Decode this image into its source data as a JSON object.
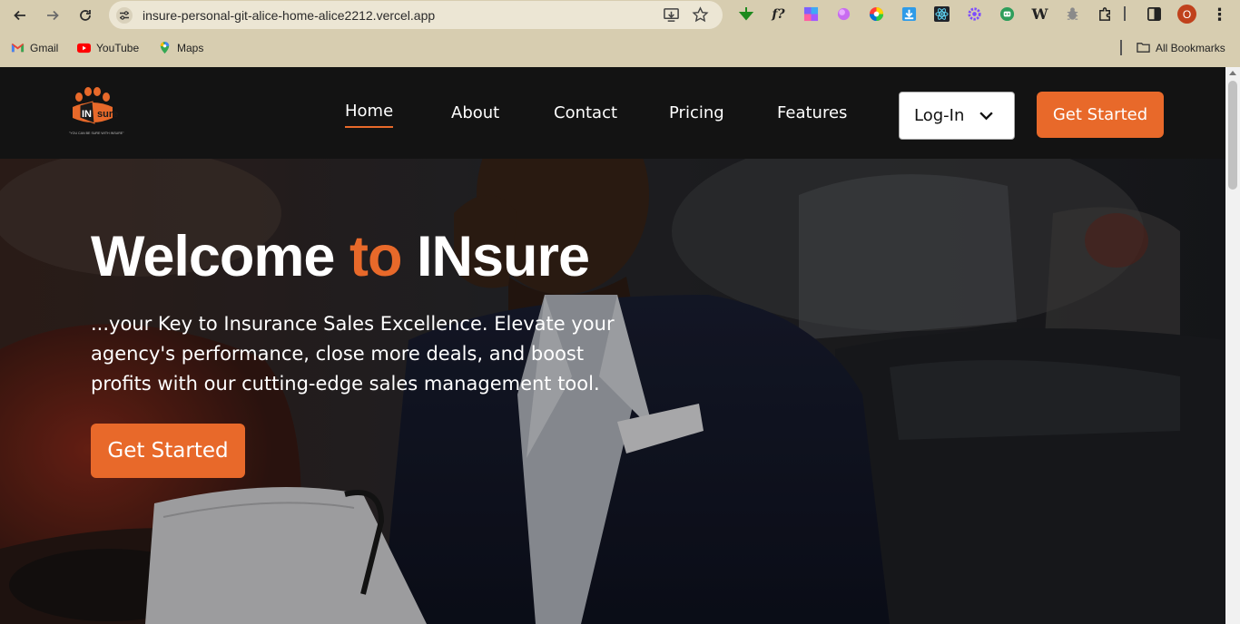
{
  "browser": {
    "url": "insure-personal-git-alice-home-alice2212.vercel.app",
    "profile_initial": "O",
    "bookmarks": [
      {
        "label": "Gmail",
        "icon": "gmail-icon"
      },
      {
        "label": "YouTube",
        "icon": "youtube-icon"
      },
      {
        "label": "Maps",
        "icon": "maps-icon"
      }
    ],
    "all_bookmarks_label": "All Bookmarks"
  },
  "site": {
    "logo_text": "INsure",
    "logo_tagline": "\"YOU CAN BE SURE WITH INSURE\"",
    "brand_color": "#e8692a",
    "nav": {
      "items": [
        "Home",
        "About",
        "Contact",
        "Pricing",
        "Features"
      ],
      "active": "Home",
      "login_label": "Log-In",
      "cta_label": "Get Started"
    },
    "hero": {
      "title_part1": "Welcome",
      "title_accent": "to",
      "title_part2": "INsure",
      "subtitle": "...your Key to Insurance Sales Excellence. Elevate your agency's performance, close more deals, and boost profits with our cutting-edge sales management tool.",
      "cta_label": "Get Started"
    }
  }
}
